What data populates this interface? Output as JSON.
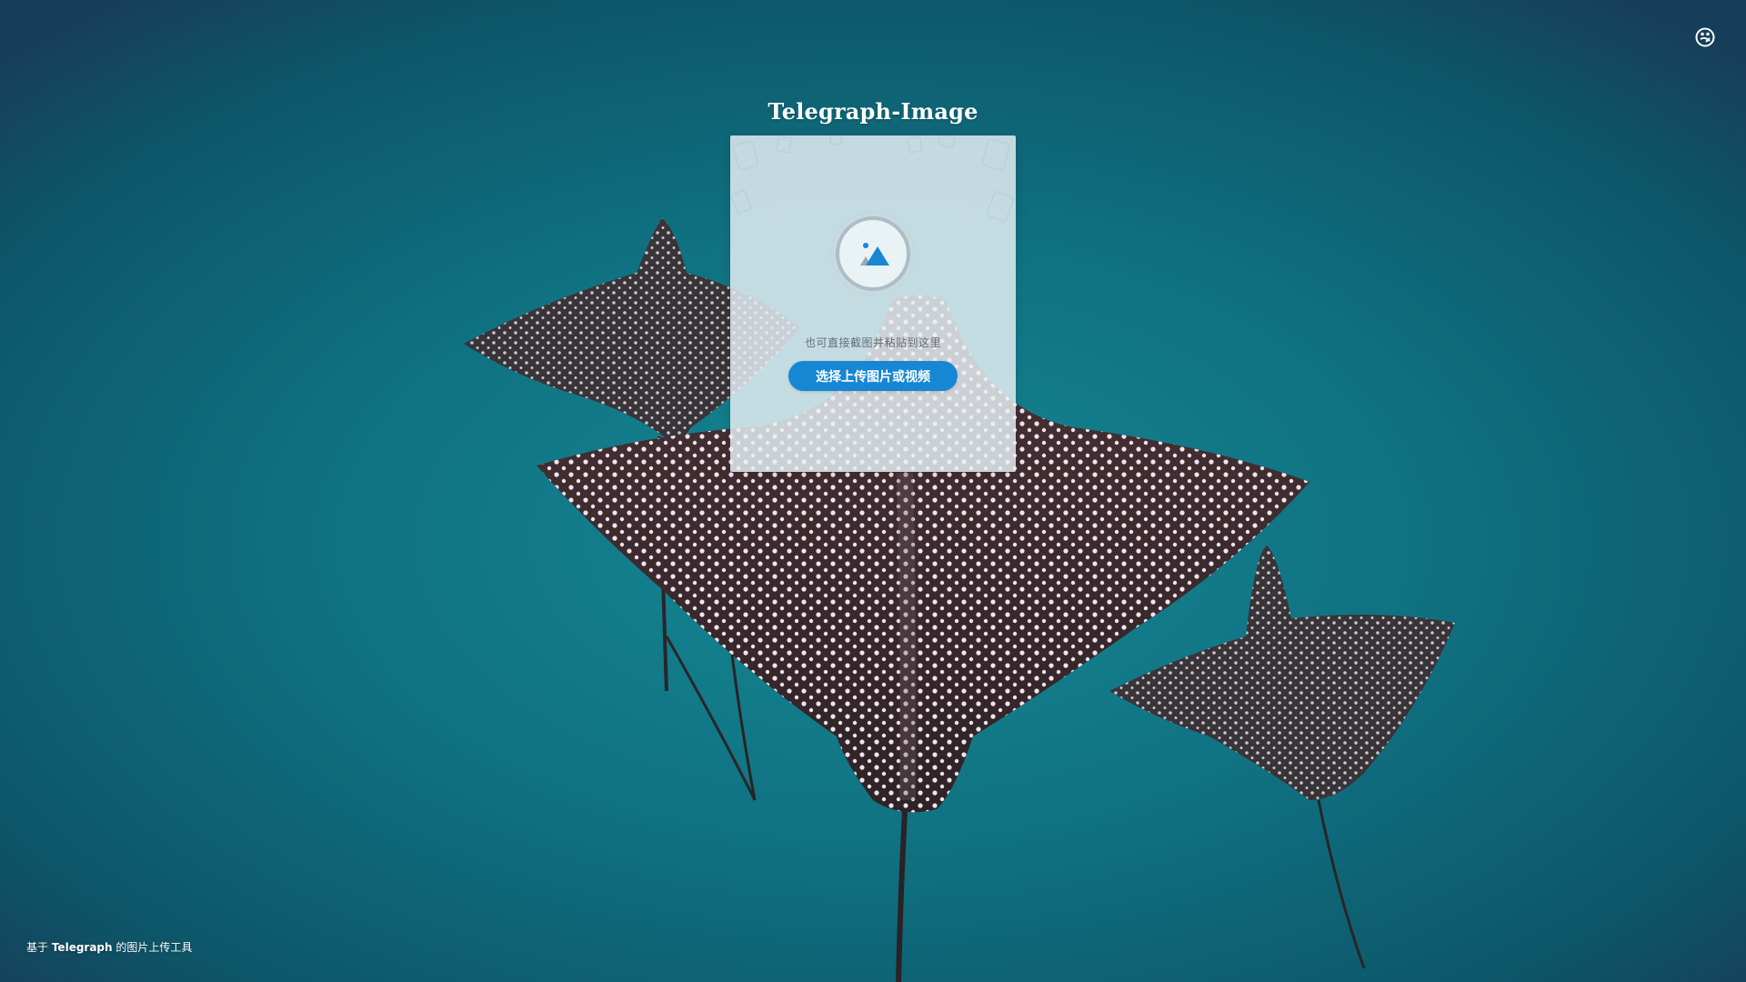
{
  "app": {
    "title": "Telegraph-Image"
  },
  "header": {
    "settings_icon": "palette-icon"
  },
  "upload": {
    "icon": "image-upload-icon",
    "hint": "也可直接截图并粘贴到这里",
    "button_label": "选择上传图片或视频",
    "button_color": "#1787d4"
  },
  "footer": {
    "prefix": "基于",
    "brand": "Telegraph",
    "suffix": "的图片上传工具"
  },
  "background": {
    "subject": "eagle-rays-underwater",
    "colors": {
      "water": "#0f6e7d",
      "ray_body": "#3a2a2e",
      "spots": "#f3eaf0"
    }
  }
}
